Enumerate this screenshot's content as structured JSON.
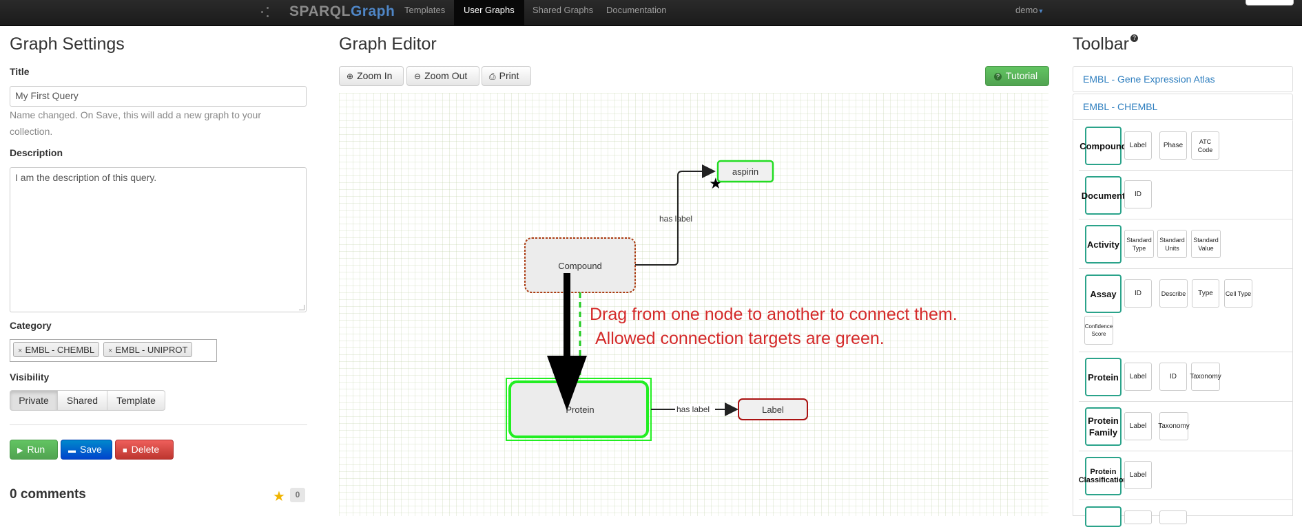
{
  "navbar": {
    "brand_part1": "SPARQL",
    "brand_part2": "Graph",
    "items": [
      "Templates",
      "User Graphs",
      "Shared Graphs",
      "Documentation"
    ],
    "active_item": "User Graphs",
    "user": "demo",
    "brand_color": "#4f86c6"
  },
  "settings": {
    "heading": "Graph Settings",
    "title_label": "Title",
    "title_value": "My First Query",
    "title_help": "Name changed. On Save, this will add a new graph to your collection.",
    "description_label": "Description",
    "description_value": "I am the description of this query.",
    "category_label": "Category",
    "categories": [
      "EMBL - CHEMBL",
      "EMBL - UNIPROT"
    ],
    "visibility_label": "Visibility",
    "visibility_options": [
      "Private",
      "Shared",
      "Template"
    ],
    "visibility_selected": "Private",
    "run_label": "Run",
    "save_label": "Save",
    "delete_label": "Delete",
    "comments_label": "0 comments",
    "star_count": "0"
  },
  "editor": {
    "heading": "Graph Editor",
    "zoom_in_label": "Zoom In",
    "zoom_out_label": "Zoom Out",
    "print_label": "Print",
    "tutorial_label": "Tutorial",
    "nodes": {
      "compound": "Compound",
      "aspirin": "aspirin",
      "protein": "Protein",
      "label": "Label"
    },
    "edges": {
      "compound_aspirin": "has label",
      "protein_label": "has label"
    },
    "hint_line1": "Drag from one node to another to connect them.",
    "hint_line2": "Allowed connection targets are green.",
    "colors": {
      "valid_target": "#22dd22",
      "invalid_target": "#aa1111",
      "hint_text": "#d42a2a"
    }
  },
  "toolbar": {
    "heading": "Toolbar",
    "accordions": [
      "EMBL - Gene Expression Atlas",
      "EMBL - CHEMBL"
    ],
    "class_border_color": "#2aa38a",
    "rows": [
      {
        "class": "Compound",
        "props": [
          "Label",
          "Phase",
          "ATC Code"
        ]
      },
      {
        "class": "Document",
        "props": [
          "ID"
        ]
      },
      {
        "class": "Activity",
        "props": [
          "Standard Type",
          "Standard Units",
          "Standard Value"
        ]
      },
      {
        "class": "Assay",
        "props": [
          "ID",
          "Describe",
          "Type",
          "Cell Type",
          "Confidence Score"
        ]
      },
      {
        "class": "Protein",
        "props": [
          "Label",
          "ID",
          "Taxonomy"
        ]
      },
      {
        "class": "Protein Family",
        "props": [
          "Label",
          "Taxonomy"
        ]
      },
      {
        "class": "Protein Classification",
        "props": [
          "Label"
        ]
      }
    ]
  }
}
